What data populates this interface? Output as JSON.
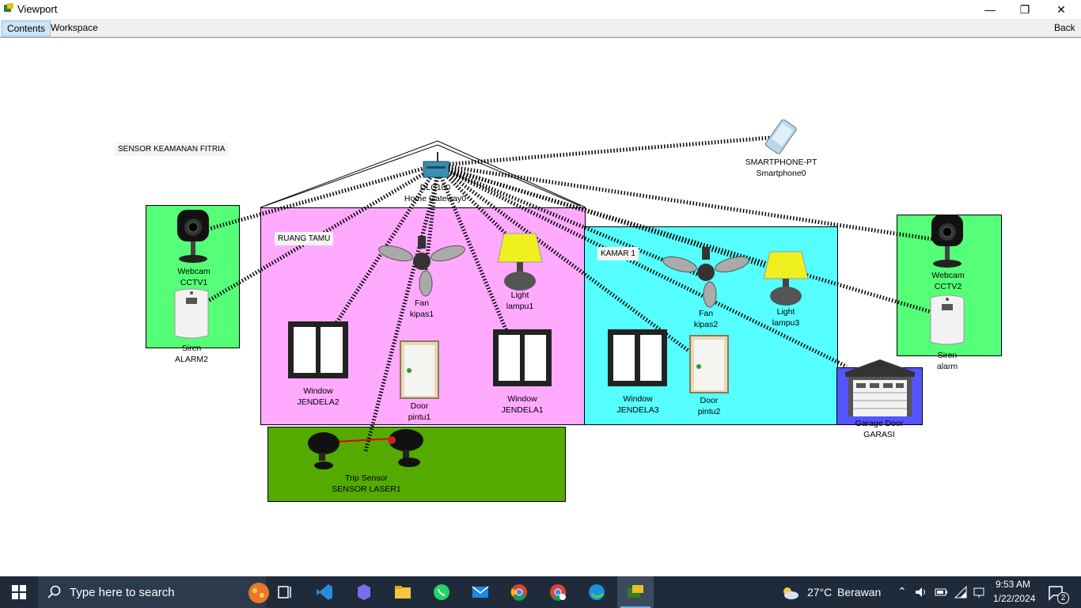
{
  "window": {
    "title": "Viewport"
  },
  "menu": {
    "contents": "Contents",
    "workspace": "Workspace",
    "back": "Back"
  },
  "canvas": {
    "note": "SENSOR KEAMANAN FITRIA",
    "rooms": {
      "living": "RUANG TAMU",
      "bedroom": "KAMAR 1"
    },
    "devices": {
      "gateway": {
        "type": "DLC100",
        "name": "Home Gateway0"
      },
      "smartphone": {
        "type": "SMARTPHONE-PT",
        "name": "Smartphone0"
      },
      "webcam1": {
        "type": "Webcam",
        "name": "CCTV1"
      },
      "siren2": {
        "type": "Siren",
        "name": "ALARM2"
      },
      "fan1": {
        "type": "Fan",
        "name": "kipas1"
      },
      "light1": {
        "type": "Light",
        "name": "lampu1"
      },
      "window2": {
        "type": "Window",
        "name": "JENDELA2"
      },
      "door1": {
        "type": "Door",
        "name": "pintu1"
      },
      "window1": {
        "type": "Window",
        "name": "JENDELA1"
      },
      "fan2": {
        "type": "Fan",
        "name": "kipas2"
      },
      "light3": {
        "type": "Light",
        "name": "lampu3"
      },
      "window3": {
        "type": "Window",
        "name": "JENDELA3"
      },
      "door2": {
        "type": "Door",
        "name": "pintu2"
      },
      "webcam2": {
        "type": "Webcam",
        "name": "CCTV2"
      },
      "siren": {
        "type": "Siren",
        "name": "alarm"
      },
      "garage": {
        "type": "Garage Door",
        "name": "GARASI"
      },
      "trip": {
        "type": "Trip Sensor",
        "name": "SENSOR LASER1"
      }
    }
  },
  "taskbar": {
    "search_placeholder": "Type here to search",
    "weather": {
      "temp": "27°C",
      "desc": "Berawan"
    },
    "time": "9:53 AM",
    "date": "1/22/2024",
    "notifications": "2"
  },
  "colors": {
    "living_room": "#ffaaff",
    "bedroom": "#55ffff",
    "outdoor_green": "#55ff77",
    "garden": "#55aa00",
    "garage": "#5555ff"
  }
}
